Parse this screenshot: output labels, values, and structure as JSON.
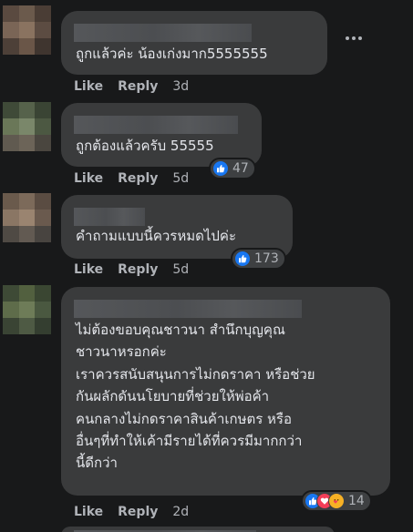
{
  "comments": [
    {
      "text": "ถูกแล้วค่ะ น้องเก่งมาก5555555",
      "like_label": "Like",
      "reply_label": "Reply",
      "time": "3d",
      "reaction_count": "",
      "reactions": []
    },
    {
      "text": "ถูกต้องแล้วครับ 55555",
      "like_label": "Like",
      "reply_label": "Reply",
      "time": "5d",
      "reaction_count": "47",
      "reactions": [
        "like"
      ]
    },
    {
      "text": "คำถามแบบนี้ควรหมดไปค่ะ",
      "like_label": "Like",
      "reply_label": "Reply",
      "time": "5d",
      "reaction_count": "173",
      "reactions": [
        "like"
      ]
    },
    {
      "text": "ไม่ต้องขอบคุณชาวนา สำนึกบุญคุณ\nชาวนาหรอกค่ะ\nเราควรสนับสนุนการไม่กดราคา หรือช่วย\nกันผลักดันนโยบายที่ช่วยให้พ่อค้า\nคนกลางไม่กดราคาสินค้าเกษตร หรือ\nอื่นๆที่ทำให้เค้ามีรายได้ที่ควรมีมากกว่า\nนี้ดีกว่า",
      "like_label": "Like",
      "reply_label": "Reply",
      "time": "2d",
      "reaction_count": "14",
      "reactions": [
        "like",
        "love",
        "care"
      ]
    }
  ],
  "colors": {
    "background": "#18191a",
    "bubble": "#3a3b3c",
    "text": "#e4e6eb",
    "secondary_text": "#b0b3b8",
    "like_blue": "#1877f2",
    "love_red": "#f33e58",
    "care_yellow": "#f7b125"
  },
  "icons": {
    "more": "more-options-icon",
    "like": "like-reaction-icon",
    "love": "love-reaction-icon",
    "care": "care-reaction-icon"
  }
}
